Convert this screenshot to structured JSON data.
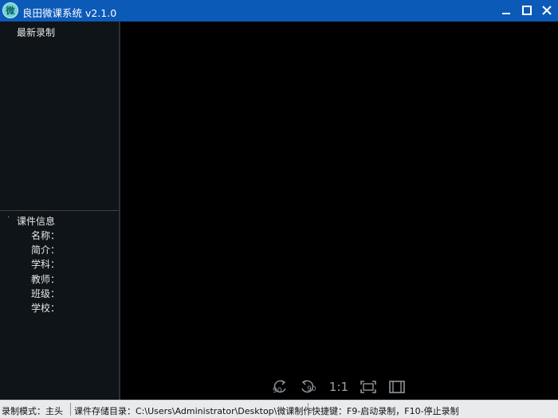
{
  "window": {
    "title": "良田微课系统 v2.1.0",
    "icon_glyph": "微",
    "controls": [
      "minimize-icon",
      "maximize-icon",
      "close-icon"
    ]
  },
  "left_panel": {
    "recent_label": "最新录制",
    "recent_items": [],
    "course_info": {
      "toggle_glyph": "·",
      "title": "课件信息",
      "fields": {
        "name": "名称：",
        "intro": "简介：",
        "subject": "学科：",
        "teacher": "教师：",
        "class": "班级：",
        "school": "学校："
      }
    }
  },
  "preview_toolbar": {
    "rotate_left_label": "90",
    "rotate_right_label": "90",
    "ratio_label": "1:1",
    "icons": [
      "rotate-left-icon",
      "rotate-right-icon",
      "fit-screen-icon",
      "fullscreen-icon"
    ]
  },
  "statusbar": {
    "record_mode": "录制模式：主头",
    "storage_dir": "课件存储目录：C:\\Users\\Administrator\\Desktop\\微课制作",
    "shortcuts": "快捷键：F9-启动录制，F10-停止录制"
  },
  "colors": {
    "titlebar": "#0c5ab8",
    "left_panel": "#0f1418",
    "preview": "#000000",
    "statusbar": "#e9eaec",
    "icon_bg": "#6fd3d0"
  }
}
